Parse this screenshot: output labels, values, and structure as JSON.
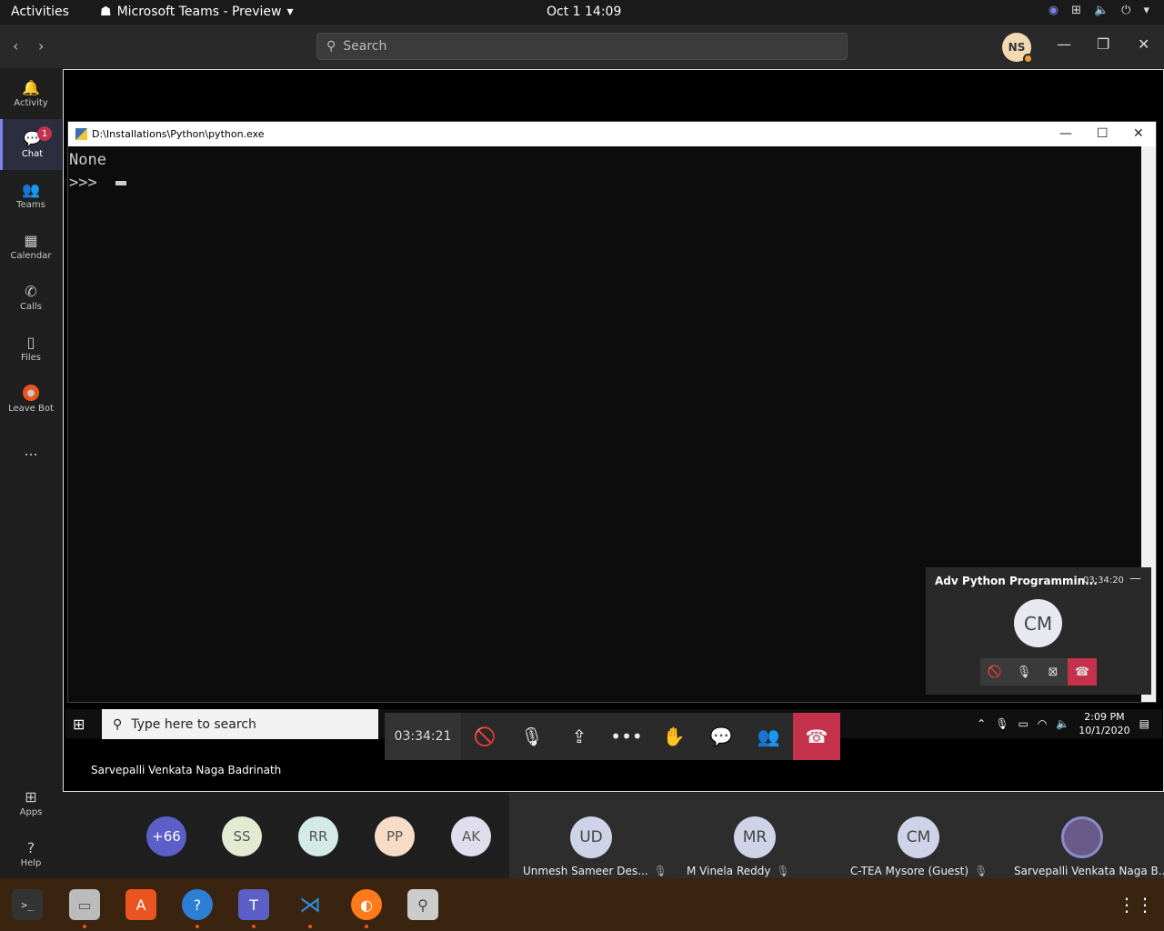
{
  "topbar": {
    "activities": "Activities",
    "app_name": "Microsoft Teams - Preview",
    "clock": "Oct 1  14:09"
  },
  "teams": {
    "search_placeholder": "Search",
    "me_initials": "NS"
  },
  "rail": {
    "items": [
      {
        "label": "Activity",
        "icon": "bell-icon"
      },
      {
        "label": "Chat",
        "icon": "chat-icon",
        "badge": "1"
      },
      {
        "label": "Teams",
        "icon": "teams-icon"
      },
      {
        "label": "Calendar",
        "icon": "calendar-icon"
      },
      {
        "label": "Calls",
        "icon": "phone-icon"
      },
      {
        "label": "Files",
        "icon": "file-icon"
      },
      {
        "label": "Leave Bot",
        "icon": "leave-bot-icon"
      }
    ],
    "more": "...",
    "apps": "Apps",
    "help": "Help"
  },
  "console_window": {
    "title": "D:\\Installations\\Python\\python.exe",
    "lines": [
      "None",
      ">>> "
    ]
  },
  "win_taskbar": {
    "search_placeholder": "Type here to search",
    "time": "2:09 PM",
    "date": "10/1/2020"
  },
  "meeting": {
    "timer": "03:34:21",
    "presenter": "Sarvepalli Venkata Naga Badrinath"
  },
  "mini_window": {
    "title": "Adv Python Programmin...",
    "timer": "03:34:20",
    "initials": "CM"
  },
  "participants": {
    "overflow": "+66",
    "small": [
      {
        "initials": "SS",
        "color": "#e4ead2"
      },
      {
        "initials": "RR",
        "color": "#d4eae6"
      },
      {
        "initials": "PP",
        "color": "#f6dcc6"
      },
      {
        "initials": "AK",
        "color": "#e0ddec"
      }
    ],
    "tiles": [
      {
        "initials": "UD",
        "name": "Unmesh Sameer Des..."
      },
      {
        "initials": "MR",
        "name": "M Vinela Reddy"
      },
      {
        "initials": "CM",
        "name": "C-TEA Mysore (Guest)"
      },
      {
        "initials": "",
        "name": "Sarvepalli Venkata Naga B..."
      }
    ]
  }
}
